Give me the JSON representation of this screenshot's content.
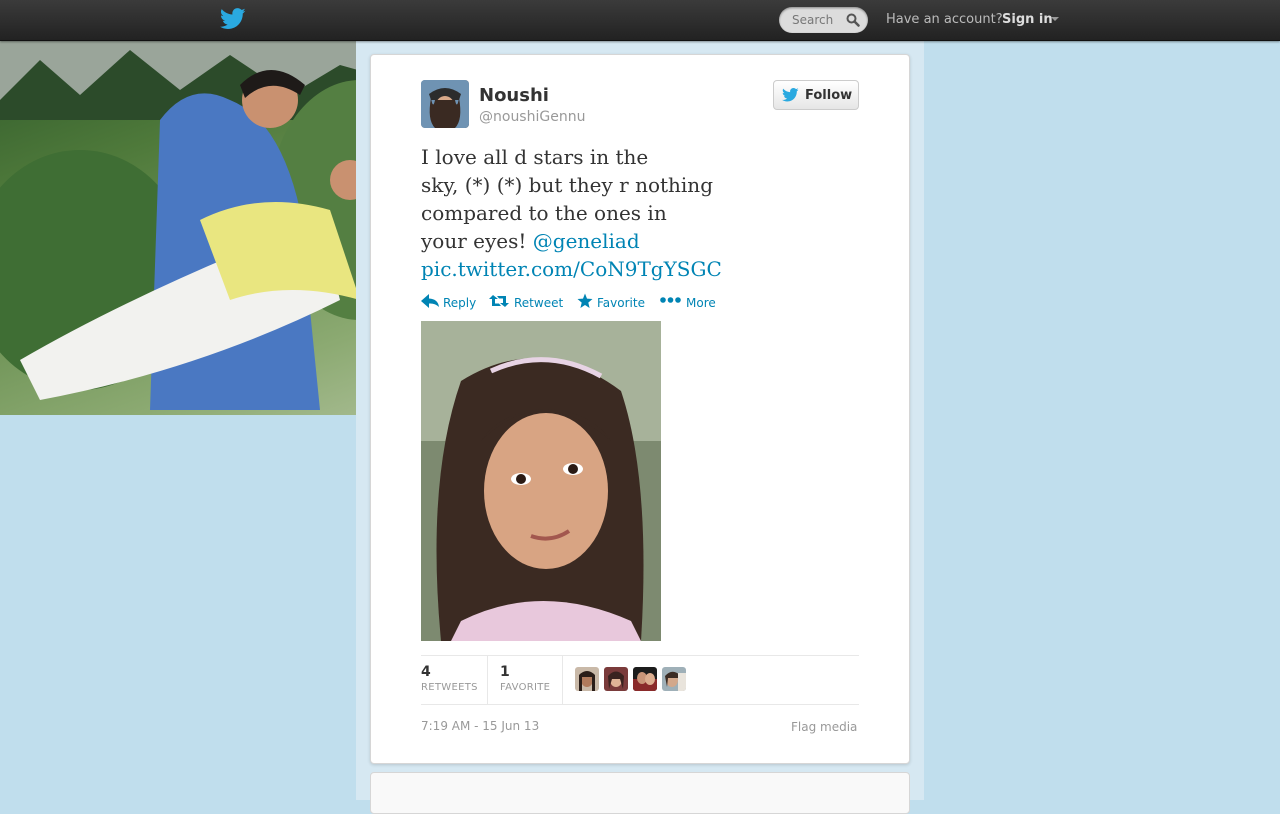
{
  "topbar": {
    "search_placeholder": "Search",
    "have_account": "Have an account?",
    "sign_in": "Sign in"
  },
  "tweet": {
    "fullname": "Noushi",
    "handle": "@noushiGennu",
    "follow_label": "Follow",
    "text_lines": [
      "I love all d stars in the",
      "sky, (*) (*) but they r nothing",
      "compared to the ones in",
      "your eyes! "
    ],
    "mention": "@geneliad",
    "pic_link": "pic.twitter.com/CoN9TgYSGC",
    "actions": {
      "reply": "Reply",
      "retweet": "Retweet",
      "favorite": "Favorite",
      "more": "More"
    },
    "stats": {
      "retweets_count": "4",
      "retweets_label": "RETWEETS",
      "favorites_count": "1",
      "favorites_label": "FAVORITE"
    },
    "timestamp": "7:19 AM - 15 Jun 13",
    "flag_media": "Flag media"
  },
  "colors": {
    "link": "#0084b4",
    "background": "#c0deed",
    "twitter_blue": "#1da1f2"
  }
}
